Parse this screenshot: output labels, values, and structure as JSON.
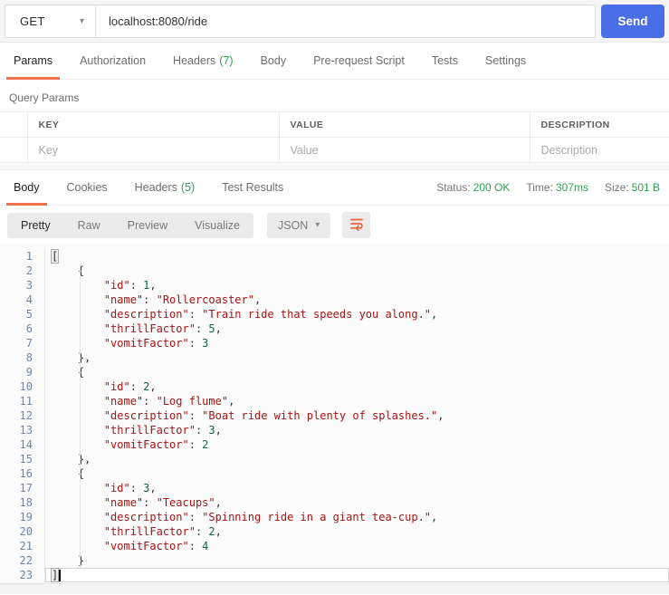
{
  "request_bar": {
    "method": "GET",
    "url": "localhost:8080/ride",
    "send_label": "Send"
  },
  "request_tabs": {
    "items": [
      {
        "label": "Params"
      },
      {
        "label": "Authorization"
      },
      {
        "label": "Headers",
        "count": "(7)"
      },
      {
        "label": "Body"
      },
      {
        "label": "Pre-request Script"
      },
      {
        "label": "Tests"
      },
      {
        "label": "Settings"
      }
    ],
    "active": "Params"
  },
  "query_params": {
    "title": "Query Params",
    "columns": [
      "KEY",
      "VALUE",
      "DESCRIPTION"
    ],
    "placeholders": [
      "Key",
      "Value",
      "Description"
    ]
  },
  "response": {
    "tabs": [
      {
        "label": "Body"
      },
      {
        "label": "Cookies"
      },
      {
        "label": "Headers",
        "count": "(5)"
      },
      {
        "label": "Test Results"
      }
    ],
    "active_tab": "Body",
    "meta": [
      {
        "label": "Status:",
        "value": "200 OK"
      },
      {
        "label": "Time:",
        "value": "307ms"
      },
      {
        "label": "Size:",
        "value": "501 B"
      }
    ],
    "view_tabs": [
      "Pretty",
      "Raw",
      "Preview",
      "Visualize"
    ],
    "active_view": "Pretty",
    "format_select": "JSON",
    "wrap_icon": "wrap-text-icon"
  },
  "colors": {
    "accent_orange": "#f0714c",
    "icon_orange": "#ef6233",
    "success_green": "#2ca24c",
    "send_blue": "#4a6ee5",
    "code_string": "#a31515",
    "code_number": "#116644",
    "line_number": "#6f87a5"
  },
  "code": {
    "language": "JSON",
    "lines": [
      {
        "t": [
          [
            "brk",
            "["
          ]
        ]
      },
      {
        "t": [
          [
            "pln",
            "    {"
          ]
        ]
      },
      {
        "t": [
          [
            "pln",
            "        "
          ],
          [
            "str",
            "\"id\""
          ],
          [
            "pln",
            ": "
          ],
          [
            "num",
            "1"
          ],
          [
            "pln",
            ","
          ]
        ]
      },
      {
        "t": [
          [
            "pln",
            "        "
          ],
          [
            "str",
            "\"name\""
          ],
          [
            "pln",
            ": "
          ],
          [
            "str",
            "\"Rollercoaster\""
          ],
          [
            "pln",
            ","
          ]
        ]
      },
      {
        "t": [
          [
            "pln",
            "        "
          ],
          [
            "str",
            "\"description\""
          ],
          [
            "pln",
            ": "
          ],
          [
            "str",
            "\"Train ride that speeds you along.\""
          ],
          [
            "pln",
            ","
          ]
        ]
      },
      {
        "t": [
          [
            "pln",
            "        "
          ],
          [
            "str",
            "\"thrillFactor\""
          ],
          [
            "pln",
            ": "
          ],
          [
            "num",
            "5"
          ],
          [
            "pln",
            ","
          ]
        ]
      },
      {
        "t": [
          [
            "pln",
            "        "
          ],
          [
            "str",
            "\"vomitFactor\""
          ],
          [
            "pln",
            ": "
          ],
          [
            "num",
            "3"
          ]
        ]
      },
      {
        "t": [
          [
            "pln",
            "    },"
          ]
        ]
      },
      {
        "t": [
          [
            "pln",
            "    {"
          ]
        ]
      },
      {
        "t": [
          [
            "pln",
            "        "
          ],
          [
            "str",
            "\"id\""
          ],
          [
            "pln",
            ": "
          ],
          [
            "num",
            "2"
          ],
          [
            "pln",
            ","
          ]
        ]
      },
      {
        "t": [
          [
            "pln",
            "        "
          ],
          [
            "str",
            "\"name\""
          ],
          [
            "pln",
            ": "
          ],
          [
            "str",
            "\"Log flume\""
          ],
          [
            "pln",
            ","
          ]
        ]
      },
      {
        "t": [
          [
            "pln",
            "        "
          ],
          [
            "str",
            "\"description\""
          ],
          [
            "pln",
            ": "
          ],
          [
            "str",
            "\"Boat ride with plenty of splashes.\""
          ],
          [
            "pln",
            ","
          ]
        ]
      },
      {
        "t": [
          [
            "pln",
            "        "
          ],
          [
            "str",
            "\"thrillFactor\""
          ],
          [
            "pln",
            ": "
          ],
          [
            "num",
            "3"
          ],
          [
            "pln",
            ","
          ]
        ]
      },
      {
        "t": [
          [
            "pln",
            "        "
          ],
          [
            "str",
            "\"vomitFactor\""
          ],
          [
            "pln",
            ": "
          ],
          [
            "num",
            "2"
          ]
        ]
      },
      {
        "t": [
          [
            "pln",
            "    },"
          ]
        ]
      },
      {
        "t": [
          [
            "pln",
            "    {"
          ]
        ]
      },
      {
        "t": [
          [
            "pln",
            "        "
          ],
          [
            "str",
            "\"id\""
          ],
          [
            "pln",
            ": "
          ],
          [
            "num",
            "3"
          ],
          [
            "pln",
            ","
          ]
        ]
      },
      {
        "t": [
          [
            "pln",
            "        "
          ],
          [
            "str",
            "\"name\""
          ],
          [
            "pln",
            ": "
          ],
          [
            "str",
            "\"Teacups\""
          ],
          [
            "pln",
            ","
          ]
        ]
      },
      {
        "t": [
          [
            "pln",
            "        "
          ],
          [
            "str",
            "\"description\""
          ],
          [
            "pln",
            ": "
          ],
          [
            "str",
            "\"Spinning ride in a giant tea-cup.\""
          ],
          [
            "pln",
            ","
          ]
        ]
      },
      {
        "t": [
          [
            "pln",
            "        "
          ],
          [
            "str",
            "\"thrillFactor\""
          ],
          [
            "pln",
            ": "
          ],
          [
            "num",
            "2"
          ],
          [
            "pln",
            ","
          ]
        ]
      },
      {
        "t": [
          [
            "pln",
            "        "
          ],
          [
            "str",
            "\"vomitFactor\""
          ],
          [
            "pln",
            ": "
          ],
          [
            "num",
            "4"
          ]
        ]
      },
      {
        "t": [
          [
            "pln",
            "    }"
          ]
        ]
      },
      {
        "t": [
          [
            "brk",
            "]"
          ]
        ],
        "active": true,
        "cursor": true
      }
    ]
  }
}
